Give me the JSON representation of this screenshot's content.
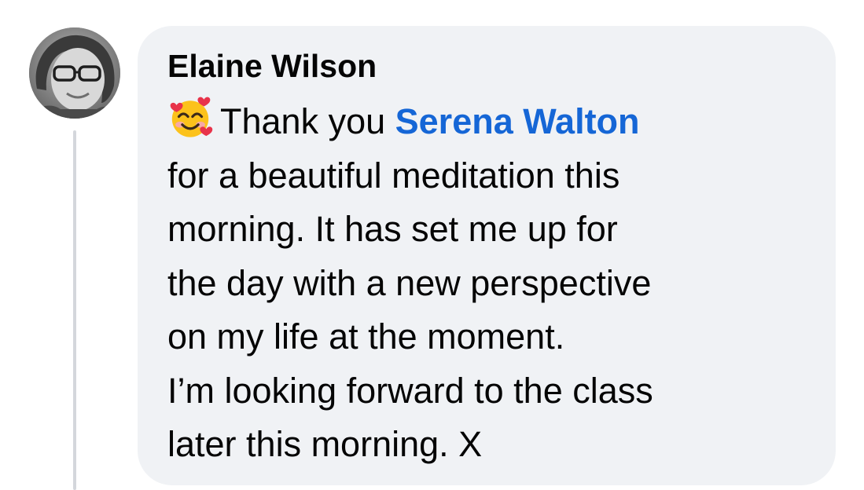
{
  "comment": {
    "author": "Elaine Wilson",
    "emoji": "smiling-face-with-hearts",
    "greeting": "Thank you",
    "mention": "Serena Walton",
    "lines": [
      "for a beautiful meditation this",
      "morning. It has set me up for",
      "the day with a new perspective",
      "on my life at the moment.",
      "I’m looking forward to the class",
      "later this morning. X"
    ]
  },
  "colors": {
    "bubble_background": "#f0f2f5",
    "text": "#050505",
    "mention": "#1566d6",
    "thread_line": "#d4d7dc"
  }
}
